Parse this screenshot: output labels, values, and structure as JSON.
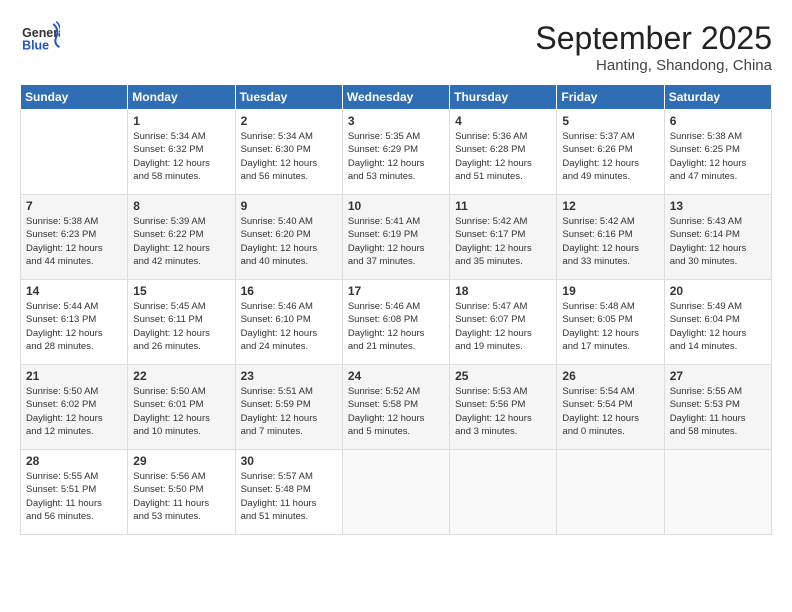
{
  "header": {
    "logo_general": "General",
    "logo_blue": "Blue",
    "month_title": "September 2025",
    "location": "Hanting, Shandong, China"
  },
  "weekdays": [
    "Sunday",
    "Monday",
    "Tuesday",
    "Wednesday",
    "Thursday",
    "Friday",
    "Saturday"
  ],
  "weeks": [
    [
      {
        "day": "",
        "info": ""
      },
      {
        "day": "1",
        "info": "Sunrise: 5:34 AM\nSunset: 6:32 PM\nDaylight: 12 hours\nand 58 minutes."
      },
      {
        "day": "2",
        "info": "Sunrise: 5:34 AM\nSunset: 6:30 PM\nDaylight: 12 hours\nand 56 minutes."
      },
      {
        "day": "3",
        "info": "Sunrise: 5:35 AM\nSunset: 6:29 PM\nDaylight: 12 hours\nand 53 minutes."
      },
      {
        "day": "4",
        "info": "Sunrise: 5:36 AM\nSunset: 6:28 PM\nDaylight: 12 hours\nand 51 minutes."
      },
      {
        "day": "5",
        "info": "Sunrise: 5:37 AM\nSunset: 6:26 PM\nDaylight: 12 hours\nand 49 minutes."
      },
      {
        "day": "6",
        "info": "Sunrise: 5:38 AM\nSunset: 6:25 PM\nDaylight: 12 hours\nand 47 minutes."
      }
    ],
    [
      {
        "day": "7",
        "info": "Sunrise: 5:38 AM\nSunset: 6:23 PM\nDaylight: 12 hours\nand 44 minutes."
      },
      {
        "day": "8",
        "info": "Sunrise: 5:39 AM\nSunset: 6:22 PM\nDaylight: 12 hours\nand 42 minutes."
      },
      {
        "day": "9",
        "info": "Sunrise: 5:40 AM\nSunset: 6:20 PM\nDaylight: 12 hours\nand 40 minutes."
      },
      {
        "day": "10",
        "info": "Sunrise: 5:41 AM\nSunset: 6:19 PM\nDaylight: 12 hours\nand 37 minutes."
      },
      {
        "day": "11",
        "info": "Sunrise: 5:42 AM\nSunset: 6:17 PM\nDaylight: 12 hours\nand 35 minutes."
      },
      {
        "day": "12",
        "info": "Sunrise: 5:42 AM\nSunset: 6:16 PM\nDaylight: 12 hours\nand 33 minutes."
      },
      {
        "day": "13",
        "info": "Sunrise: 5:43 AM\nSunset: 6:14 PM\nDaylight: 12 hours\nand 30 minutes."
      }
    ],
    [
      {
        "day": "14",
        "info": "Sunrise: 5:44 AM\nSunset: 6:13 PM\nDaylight: 12 hours\nand 28 minutes."
      },
      {
        "day": "15",
        "info": "Sunrise: 5:45 AM\nSunset: 6:11 PM\nDaylight: 12 hours\nand 26 minutes."
      },
      {
        "day": "16",
        "info": "Sunrise: 5:46 AM\nSunset: 6:10 PM\nDaylight: 12 hours\nand 24 minutes."
      },
      {
        "day": "17",
        "info": "Sunrise: 5:46 AM\nSunset: 6:08 PM\nDaylight: 12 hours\nand 21 minutes."
      },
      {
        "day": "18",
        "info": "Sunrise: 5:47 AM\nSunset: 6:07 PM\nDaylight: 12 hours\nand 19 minutes."
      },
      {
        "day": "19",
        "info": "Sunrise: 5:48 AM\nSunset: 6:05 PM\nDaylight: 12 hours\nand 17 minutes."
      },
      {
        "day": "20",
        "info": "Sunrise: 5:49 AM\nSunset: 6:04 PM\nDaylight: 12 hours\nand 14 minutes."
      }
    ],
    [
      {
        "day": "21",
        "info": "Sunrise: 5:50 AM\nSunset: 6:02 PM\nDaylight: 12 hours\nand 12 minutes."
      },
      {
        "day": "22",
        "info": "Sunrise: 5:50 AM\nSunset: 6:01 PM\nDaylight: 12 hours\nand 10 minutes."
      },
      {
        "day": "23",
        "info": "Sunrise: 5:51 AM\nSunset: 5:59 PM\nDaylight: 12 hours\nand 7 minutes."
      },
      {
        "day": "24",
        "info": "Sunrise: 5:52 AM\nSunset: 5:58 PM\nDaylight: 12 hours\nand 5 minutes."
      },
      {
        "day": "25",
        "info": "Sunrise: 5:53 AM\nSunset: 5:56 PM\nDaylight: 12 hours\nand 3 minutes."
      },
      {
        "day": "26",
        "info": "Sunrise: 5:54 AM\nSunset: 5:54 PM\nDaylight: 12 hours\nand 0 minutes."
      },
      {
        "day": "27",
        "info": "Sunrise: 5:55 AM\nSunset: 5:53 PM\nDaylight: 11 hours\nand 58 minutes."
      }
    ],
    [
      {
        "day": "28",
        "info": "Sunrise: 5:55 AM\nSunset: 5:51 PM\nDaylight: 11 hours\nand 56 minutes."
      },
      {
        "day": "29",
        "info": "Sunrise: 5:56 AM\nSunset: 5:50 PM\nDaylight: 11 hours\nand 53 minutes."
      },
      {
        "day": "30",
        "info": "Sunrise: 5:57 AM\nSunset: 5:48 PM\nDaylight: 11 hours\nand 51 minutes."
      },
      {
        "day": "",
        "info": ""
      },
      {
        "day": "",
        "info": ""
      },
      {
        "day": "",
        "info": ""
      },
      {
        "day": "",
        "info": ""
      }
    ]
  ]
}
